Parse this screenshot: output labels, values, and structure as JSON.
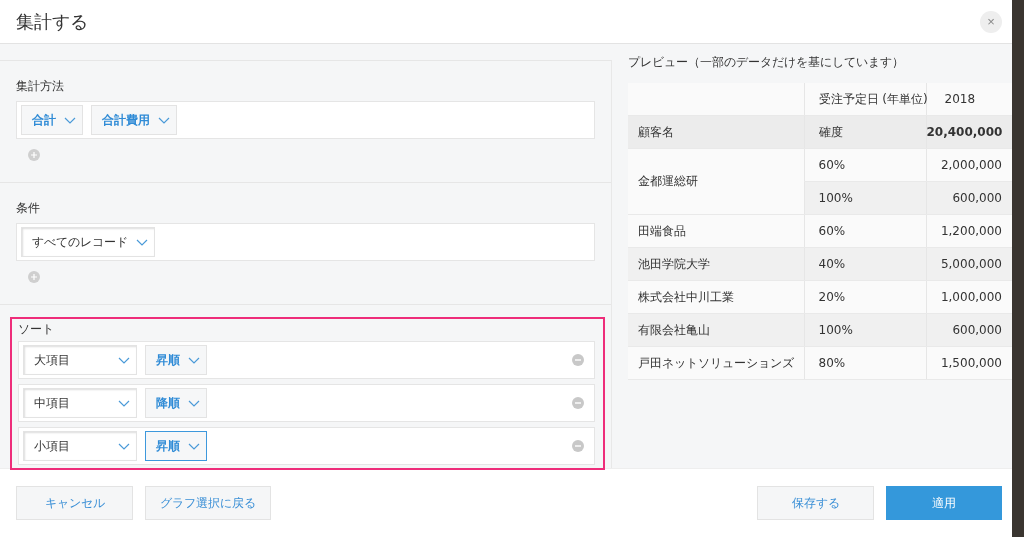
{
  "dialog": {
    "title": "集計する",
    "close": "×"
  },
  "sections": [
    {
      "label": "集計方法",
      "add": true,
      "rows": [
        {
          "removable": false,
          "dropdowns": [
            {
              "kind": "option",
              "value": "合計",
              "focused": false
            },
            {
              "kind": "option",
              "value": "合計費用",
              "focused": false
            }
          ]
        }
      ],
      "highlighted": false
    },
    {
      "label": "条件",
      "add": true,
      "rows": [
        {
          "removable": false,
          "dropdowns": [
            {
              "kind": "field",
              "value": "すべてのレコード",
              "focused": false
            }
          ]
        }
      ],
      "highlighted": false
    },
    {
      "label": "ソート",
      "add": false,
      "highlighted": true,
      "rows": [
        {
          "removable": true,
          "dropdowns": [
            {
              "kind": "field",
              "value": "大項目",
              "focused": false
            },
            {
              "kind": "option",
              "value": "昇順",
              "focused": false
            }
          ]
        },
        {
          "removable": true,
          "dropdowns": [
            {
              "kind": "field",
              "value": "中項目",
              "focused": false
            },
            {
              "kind": "option",
              "value": "降順",
              "focused": false
            }
          ]
        },
        {
          "removable": true,
          "dropdowns": [
            {
              "kind": "field",
              "value": "小項目",
              "focused": false
            },
            {
              "kind": "option",
              "value": "昇順",
              "focused": true
            }
          ]
        }
      ]
    }
  ],
  "preview": {
    "title": "プレビュー（一部のデータだけを基にしています）",
    "table": {
      "header": [
        "受注予定日 (年単位)",
        "2018"
      ],
      "subheader": [
        "顧客名",
        "確度",
        "20,400,000"
      ],
      "rows": [
        {
          "customer": "金都運総研",
          "entries": [
            {
              "rate": "60%",
              "amount": "2,000,000"
            },
            {
              "rate": "100%",
              "amount": "600,000"
            }
          ]
        },
        {
          "customer": "田端食品",
          "entries": [
            {
              "rate": "60%",
              "amount": "1,200,000"
            }
          ]
        },
        {
          "customer": "池田学院大学",
          "entries": [
            {
              "rate": "40%",
              "amount": "5,000,000"
            }
          ]
        },
        {
          "customer": "株式会社中川工業",
          "entries": [
            {
              "rate": "20%",
              "amount": "1,000,000"
            }
          ]
        },
        {
          "customer": "有限会社亀山",
          "entries": [
            {
              "rate": "100%",
              "amount": "600,000"
            }
          ]
        },
        {
          "customer": "戸田ネットソリューションズ",
          "entries": [
            {
              "rate": "80%",
              "amount": "1,500,000"
            }
          ]
        }
      ]
    }
  },
  "footer": {
    "left_buttons": [
      "キャンセル",
      "グラフ選択に戻る"
    ],
    "right_buttons": [
      {
        "label": "保存する",
        "kind": "secondary"
      },
      {
        "label": "適用",
        "kind": "primary"
      }
    ]
  }
}
